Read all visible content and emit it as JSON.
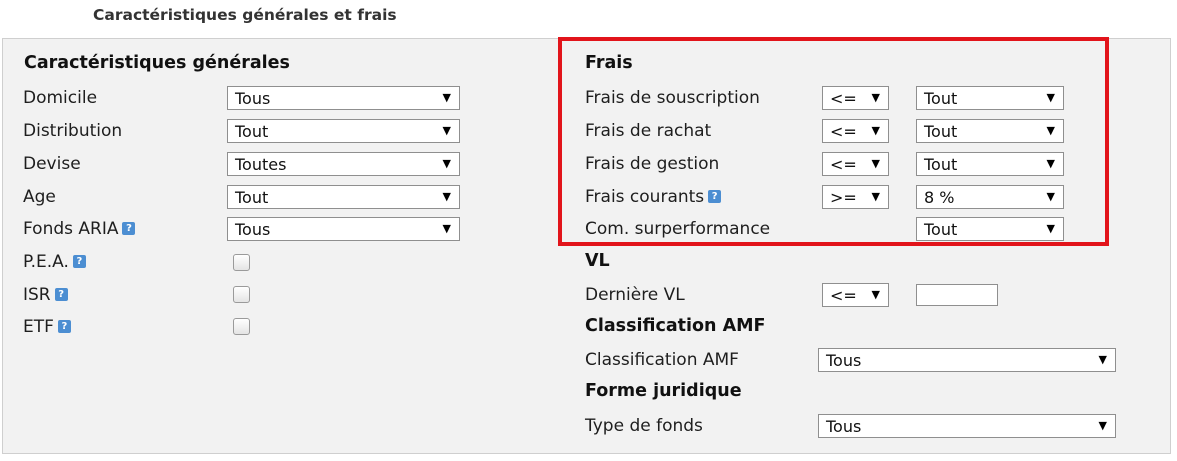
{
  "section_title": "Caractéristiques générales et frais",
  "left": {
    "heading": "Caractéristiques générales",
    "rows": [
      {
        "label": "Domicile",
        "value": "Tous"
      },
      {
        "label": "Distribution",
        "value": "Tout"
      },
      {
        "label": "Devise",
        "value": "Toutes"
      },
      {
        "label": "Age",
        "value": "Tout"
      },
      {
        "label": "Fonds ARIA",
        "value": "Tous",
        "help": "?"
      }
    ],
    "checks": [
      {
        "label": "P.E.A.",
        "help": "?",
        "checked": false
      },
      {
        "label": "ISR",
        "help": "?",
        "checked": false
      },
      {
        "label": "ETF",
        "help": "?",
        "checked": false
      }
    ]
  },
  "frais": {
    "heading": "Frais",
    "rows": [
      {
        "label": "Frais de souscription",
        "op": "<=",
        "value": "Tout"
      },
      {
        "label": "Frais de rachat",
        "op": "<=",
        "value": "Tout"
      },
      {
        "label": "Frais de gestion",
        "op": "<=",
        "value": "Tout"
      },
      {
        "label": "Frais courants",
        "op": ">=",
        "value": "8 %",
        "help": "?"
      },
      {
        "label": "Com. surperformance",
        "value": "Tout"
      }
    ]
  },
  "vl": {
    "heading": "VL",
    "label": "Dernière VL",
    "op": "<=",
    "value": ""
  },
  "amf": {
    "heading": "Classification AMF",
    "label": "Classification AMF",
    "value": "Tous"
  },
  "forme": {
    "heading": "Forme juridique",
    "label": "Type de fonds",
    "value": "Tous"
  },
  "arrow": "▼",
  "colors": {
    "highlight_border": "#e2141b",
    "panel_bg": "#f2f2f2",
    "help_icon": "#4c8ed2"
  }
}
